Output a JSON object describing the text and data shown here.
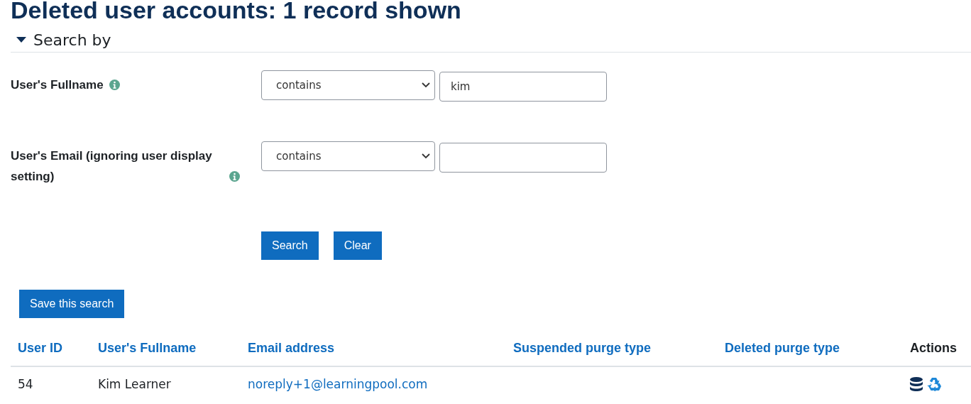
{
  "page_title": "Deleted user accounts: 1 record shown",
  "search_section": {
    "title": "Search by",
    "expanded": true,
    "filters": [
      {
        "label": "User's Fullname",
        "operator": "contains",
        "value": "kim"
      },
      {
        "label": "User's Email (ignoring user display setting)",
        "operator": "contains"
      }
    ],
    "buttons": [
      "Search",
      "Clear"
    ]
  },
  "save_button": "Save this search",
  "table": {
    "columns": [
      {
        "label": "User ID",
        "sortable": true
      },
      {
        "label": "User's Fullname",
        "sortable": true
      },
      {
        "label": "Email address",
        "sortable": true
      },
      {
        "label": "Suspended purge type",
        "sortable": true
      },
      {
        "label": "Deleted purge type",
        "sortable": true
      },
      {
        "label": "Actions",
        "sortable": false
      }
    ],
    "rows": [
      {
        "user_id": "54",
        "fullname": "Kim Learner",
        "email": "noreply+1@learningpool.com"
      }
    ]
  }
}
